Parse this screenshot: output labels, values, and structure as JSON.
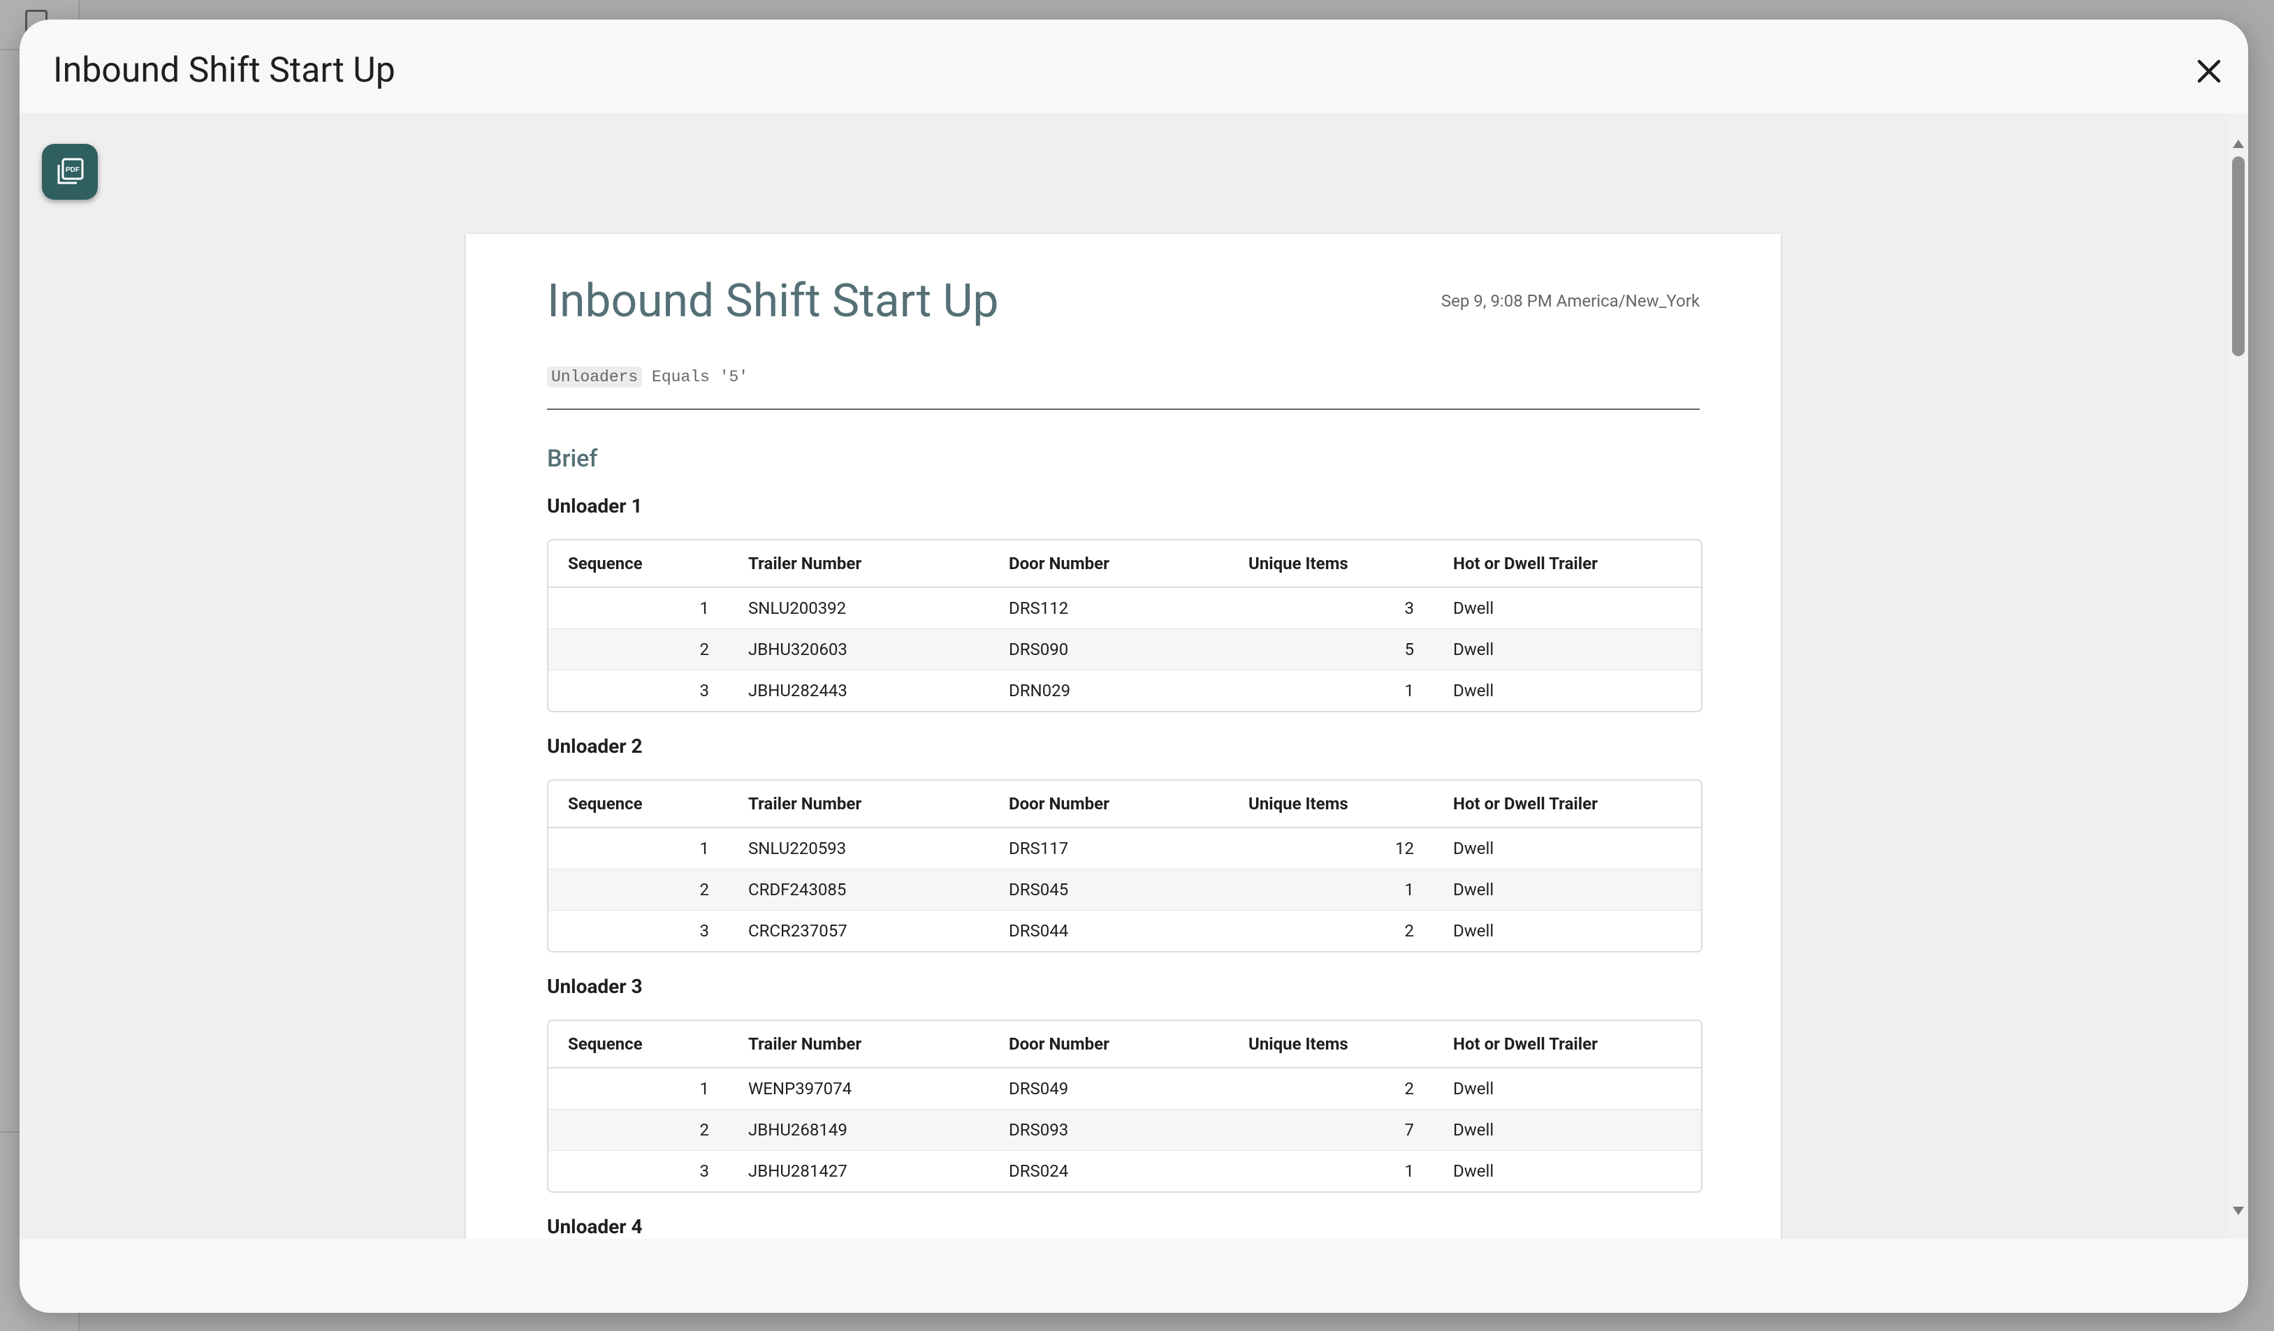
{
  "modal": {
    "title": "Inbound Shift Start Up"
  },
  "report": {
    "title": "Inbound Shift Start Up",
    "timestamp": "Sep 9, 9:08 PM America/New_York",
    "filter": {
      "field": "Unloaders",
      "operator": "Equals",
      "value": "'5'"
    },
    "section_heading": "Brief",
    "columns": [
      "Sequence",
      "Trailer Number",
      "Door Number",
      "Unique Items",
      "Hot or Dwell Trailer"
    ],
    "groups": [
      {
        "title": "Unloader 1",
        "rows": [
          {
            "sequence": "1",
            "trailer": "SNLU200392",
            "door": "DRS112",
            "items": "3",
            "status": "Dwell"
          },
          {
            "sequence": "2",
            "trailer": "JBHU320603",
            "door": "DRS090",
            "items": "5",
            "status": "Dwell"
          },
          {
            "sequence": "3",
            "trailer": "JBHU282443",
            "door": "DRN029",
            "items": "1",
            "status": "Dwell"
          }
        ]
      },
      {
        "title": "Unloader 2",
        "rows": [
          {
            "sequence": "1",
            "trailer": "SNLU220593",
            "door": "DRS117",
            "items": "12",
            "status": "Dwell"
          },
          {
            "sequence": "2",
            "trailer": "CRDF243085",
            "door": "DRS045",
            "items": "1",
            "status": "Dwell"
          },
          {
            "sequence": "3",
            "trailer": "CRCR237057",
            "door": "DRS044",
            "items": "2",
            "status": "Dwell"
          }
        ]
      },
      {
        "title": "Unloader 3",
        "rows": [
          {
            "sequence": "1",
            "trailer": "WENP397074",
            "door": "DRS049",
            "items": "2",
            "status": "Dwell"
          },
          {
            "sequence": "2",
            "trailer": "JBHU268149",
            "door": "DRS093",
            "items": "7",
            "status": "Dwell"
          },
          {
            "sequence": "3",
            "trailer": "JBHU281427",
            "door": "DRS024",
            "items": "1",
            "status": "Dwell"
          }
        ]
      },
      {
        "title": "Unloader 4",
        "rows": []
      }
    ]
  },
  "icons": {
    "close": "close-icon",
    "pdf": "pdf-icon",
    "panel": "sidebar-panel-icon"
  },
  "colors": {
    "accent": "#2f5f5f",
    "heading": "#557076"
  }
}
